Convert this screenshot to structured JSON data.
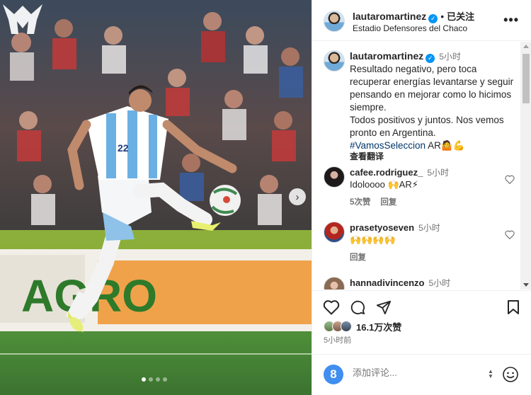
{
  "post": {
    "background_banner": "AGRO",
    "next_label": "›",
    "carousel_pages": 4,
    "carousel_active": 1
  },
  "header": {
    "username": "lautaromartinez",
    "verified_mark": "✓",
    "separator": "•",
    "follow_label": "已关注",
    "location": "Estadio Defensores del Chaco",
    "more_label": "•••"
  },
  "caption": {
    "username": "lautaromartinez",
    "time": "5小时",
    "lines": [
      "Resultado negativo, pero toca recuperar energías levantarse y seguir pensando en mejorar como lo hicimos siempre.",
      "Todos positivos y juntos. Nos vemos pronto en Argentina."
    ],
    "hashtag": "#VamosSeleccion",
    "suffix": " AR🤷💪",
    "translate_label": "查看翻译"
  },
  "comments": [
    {
      "username": "cafee.rodriguez_",
      "time": "5小时",
      "text": "Idoloooo 🙌AR⚡",
      "likes": "5次赞",
      "reply": "回复"
    },
    {
      "username": "prasetyoseven",
      "time": "5小时",
      "text": "🙌🙌🙌🙌",
      "likes": "",
      "reply": "回复"
    },
    {
      "username": "hannadivincenzo",
      "time": "5小时",
      "text": "",
      "likes": "",
      "reply": ""
    }
  ],
  "engagement": {
    "likes_text": "16.1万次赞",
    "post_time": "5小时前"
  },
  "comment_box": {
    "placeholder": "添加评论...",
    "badge": "8"
  },
  "colors": {
    "accent_blue": "#0095f6",
    "hashtag": "#00376b",
    "muted": "#737373"
  },
  "icons": [
    "heart-icon",
    "comment-icon",
    "share-icon",
    "bookmark-icon",
    "emoji-icon",
    "more-icon",
    "verified-icon"
  ]
}
